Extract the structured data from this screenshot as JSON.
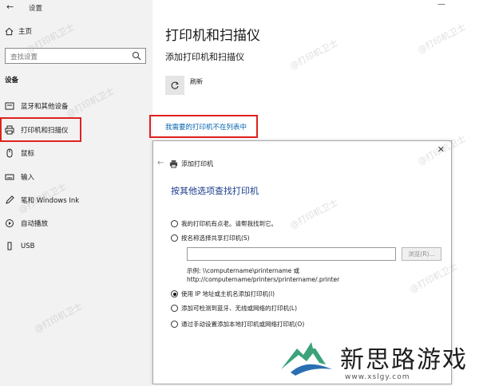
{
  "settings_window": {
    "title": "设置",
    "home_label": "主页",
    "search_placeholder": "查找设置",
    "section_label": "设备",
    "nav_items": [
      {
        "label": "蓝牙和其他设备",
        "icon": "bluetooth-icon"
      },
      {
        "label": "打印机和扫描仪",
        "icon": "printer-icon",
        "selected": true
      },
      {
        "label": "鼠标",
        "icon": "mouse-icon"
      },
      {
        "label": "输入",
        "icon": "keyboard-icon"
      },
      {
        "label": "笔和 Windows Ink",
        "icon": "pen-icon"
      },
      {
        "label": "自动播放",
        "icon": "autoplay-icon"
      },
      {
        "label": "USB",
        "icon": "usb-icon"
      }
    ]
  },
  "main": {
    "title": "打印机和扫描仪",
    "subtitle": "添加打印机和扫描仪",
    "refresh_label": "刷新",
    "not_listed_link": "我需要的打印机不在列表中"
  },
  "dialog": {
    "title": "添加打印机",
    "heading": "按其他选项查找打印机",
    "options": [
      {
        "label": "我的打印机有点老。请帮我找到它。",
        "checked": false
      },
      {
        "label": "按名称选择共享打印机(S)",
        "checked": false
      },
      {
        "label": "使用 IP 地址或主机名添加打印机(I)",
        "checked": true
      },
      {
        "label": "添加可检测到蓝牙、无线或网络的打印机(L)",
        "checked": false
      },
      {
        "label": "通过手动设置添加本地打印机或网络打印机(O)",
        "checked": false
      }
    ],
    "share_input_value": "",
    "browse_label": "浏览(R)...",
    "example_line1": "示例: \\\\computername\\printername 或",
    "example_line2": "http://computername/printers/printername/.printer"
  },
  "watermark": "@打印机卫士",
  "brand": {
    "name": "新思路游戏",
    "url": "www.xslgy.com",
    "colors": {
      "mountain_green": "#3aa37a",
      "mountain_blue": "#2b6fb3"
    }
  },
  "colors": {
    "highlight_red": "#e0211d",
    "link_blue": "#0063b1"
  }
}
